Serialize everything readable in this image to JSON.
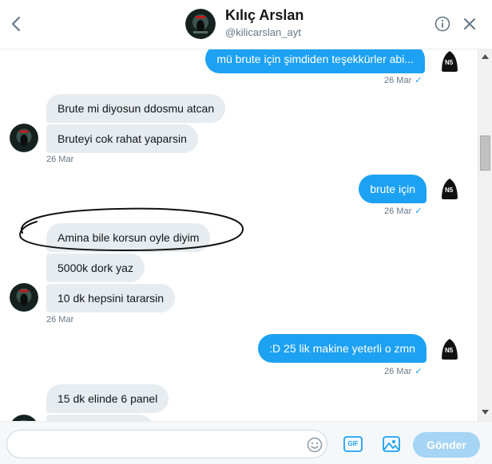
{
  "header": {
    "name": "Kılıç Arslan",
    "handle": "@kilicarslan_ayt"
  },
  "messages": [
    {
      "text": "mü brute için şimdiden teşekkürler abi...",
      "side": "sent"
    },
    {
      "text": "Brute mi diyosun ddosmu atcan",
      "side": "recv"
    },
    {
      "text": "Bruteyi cok rahat yaparsin",
      "side": "recv"
    },
    {
      "text": "brute için",
      "side": "sent"
    },
    {
      "text": "Amina  bile korsun oyle diyim",
      "side": "recv"
    },
    {
      "text": "5000k dork  yaz",
      "side": "recv"
    },
    {
      "text": "10 dk hepsini tararsin",
      "side": "recv"
    },
    {
      "text": ":D 25 lik makine yeterli o zmn",
      "side": "sent"
    },
    {
      "text": "15 dk elinde 6 panel",
      "side": "recv"
    }
  ],
  "timestamps": {
    "t1": "26 Mar",
    "t2": "26 Mar",
    "t3": "26 Mar",
    "t4": "26 Mar",
    "t5": "26 Mar"
  },
  "composer": {
    "placeholder": "",
    "gif_label": "GIF",
    "send_label": "Gönder"
  },
  "icons": {
    "back": "chevron-left-icon",
    "info": "info-icon",
    "close": "close-icon",
    "emoji": "emoji-icon",
    "gif": "gif-icon",
    "media": "image-icon"
  },
  "colors": {
    "accent": "#1da1f2",
    "received_bubble": "#e6ecf0",
    "send_disabled": "#a5d4f4"
  }
}
